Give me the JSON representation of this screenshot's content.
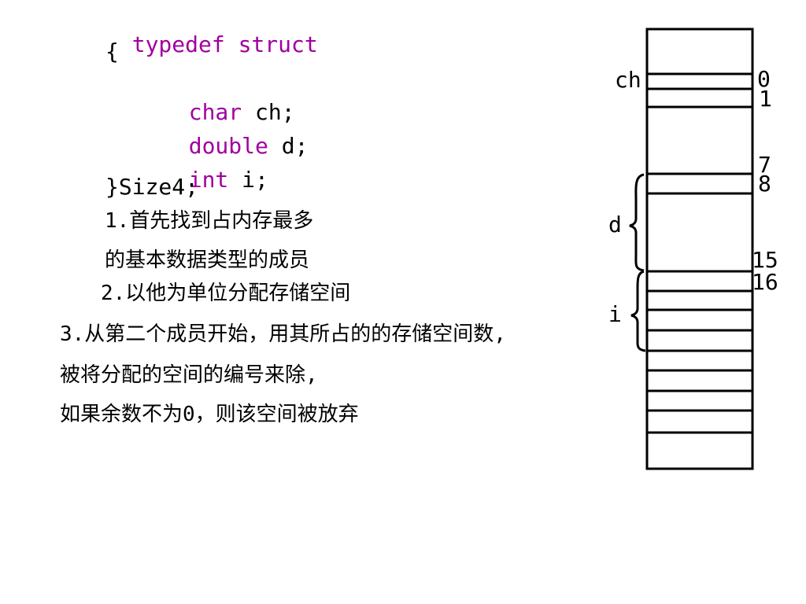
{
  "code": {
    "line1_kw1": "typedef",
    "line1_kw2": "struct",
    "line2": "{",
    "line3_kw": "char",
    "line3_rest": " ch;",
    "line4_kw": "double",
    "line4_rest": " d;",
    "line5_kw": "int",
    "line5_rest": " i;",
    "line6": "}Size4;"
  },
  "notes": {
    "step1a": "1.首先找到占内存最多",
    "step1b": "的基本数据类型的成员",
    "step2": "2.以他为单位分配存储空间",
    "step3a": "3.从第二个成员开始，用其所占的的存储空间数,",
    "step3b": "被将分配的空间的编号来除,",
    "step3c": "如果余数不为0，则该空间被放弃"
  },
  "memory": {
    "labels": {
      "ch": "ch",
      "d": "d",
      "i": "i"
    },
    "offsets": [
      "0",
      "1",
      "7",
      "8",
      "15",
      "16"
    ]
  },
  "colors": {
    "keyword": "#a000a0",
    "text": "#000000"
  }
}
